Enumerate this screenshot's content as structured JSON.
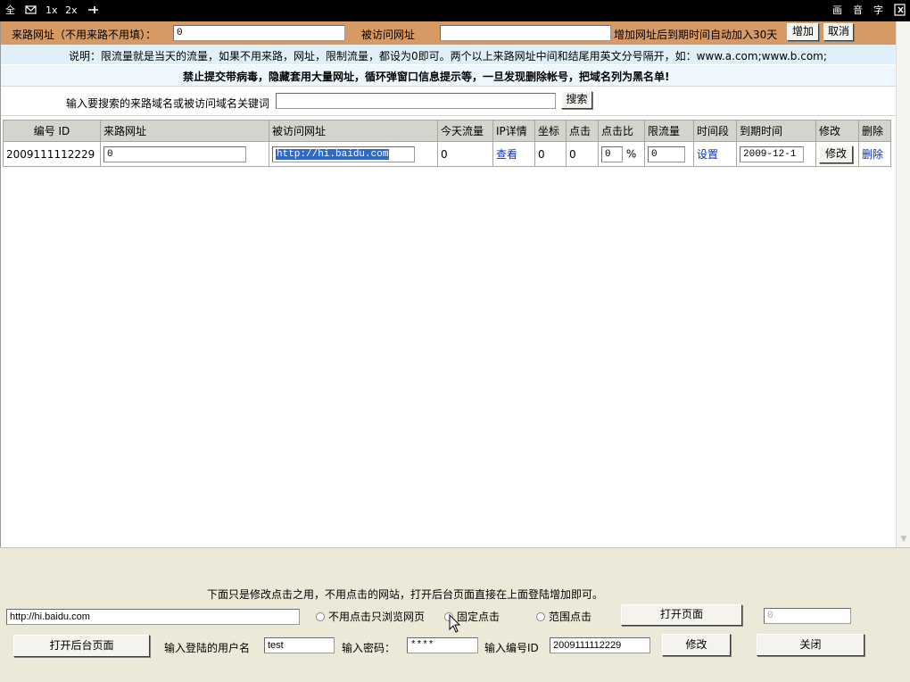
{
  "toolbar": {
    "left": [
      "全",
      "1x",
      "2x"
    ],
    "right": [
      "画",
      "音",
      "字"
    ]
  },
  "add_row": {
    "referrer_label": "来路网址（不用来路不用填）：",
    "referrer_value": "0",
    "target_label": "被访问网址",
    "target_value": "",
    "hint": "增加网址后到期时间自动加入30天",
    "add_button": "增加",
    "cancel_button": "取消"
  },
  "note": "说明：限流量就是当天的流量，如果不用来路，网址，限制流量，都设为0即可。两个以上来路网址中间和结尾用英文分号隔开，如：www.a.com;www.b.com;",
  "warning": "禁止提交带病毒，隐藏套用大量网址，循环弹窗口信息提示等，一旦发现删除帐号，把域名列为黑名单!",
  "search": {
    "label": "输入要搜索的来路域名或被访问域名关键词",
    "value": "",
    "button": "搜索"
  },
  "table": {
    "headers": [
      "编号 ID",
      "来路网址",
      "被访问网址",
      "今天流量",
      "IP详情",
      "坐标",
      "点击",
      "点击比",
      "限流量",
      "时间段",
      "到期时间",
      "修改",
      "删除"
    ],
    "row": {
      "id": "2009111112229",
      "referrer": "0",
      "target": "http://hi.baidu.com",
      "today_traffic": "0",
      "ip_detail": "查看",
      "coord": "0",
      "clicks": "0",
      "click_ratio": "0",
      "percent": "%",
      "limit": "0",
      "time_period": "设置",
      "expire": "2009-12-1",
      "edit": "修改",
      "delete": "删除"
    }
  },
  "bottom": {
    "note": "下面只是修改点击之用，不用点击的网站，打开后台页面直接在上面登陆增加即可。",
    "url_value": "http://hi.baidu.com",
    "radio_browse": "不用点击只浏览网页",
    "radio_fixed": "固定点击",
    "radio_range": "范围点击",
    "open_page": "打开页面",
    "small_input": "0",
    "open_admin": "打开后台页面",
    "username_label": "输入登陆的用户名",
    "username_value": "test",
    "password_label": "输入密码：",
    "password_value": "****",
    "id_label": "输入编号ID",
    "id_value": "2009111112229",
    "modify": "修改",
    "close": "关闭"
  }
}
